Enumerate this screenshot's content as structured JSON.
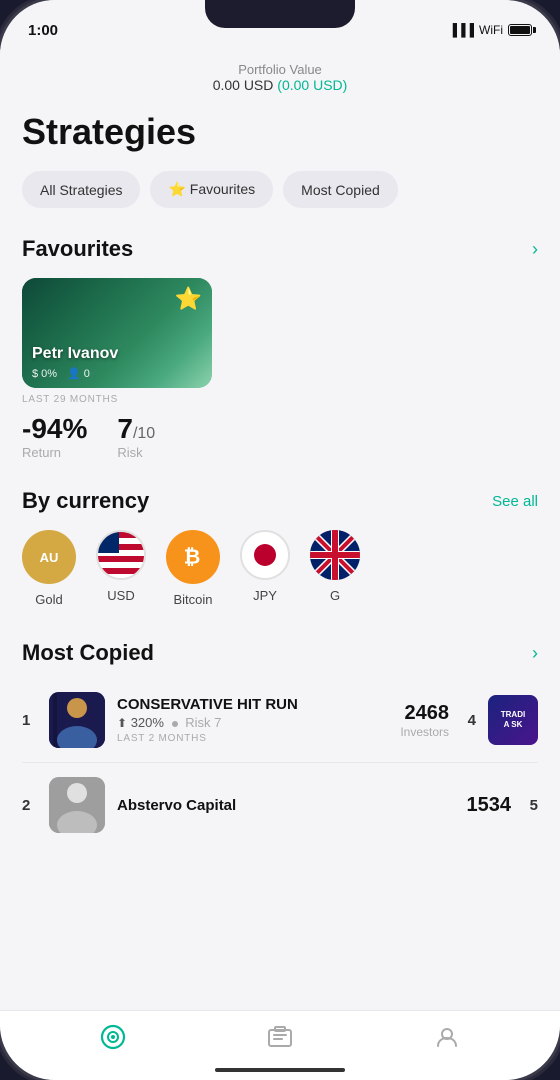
{
  "status": {
    "time": "1:00",
    "location_icon": "↗"
  },
  "portfolio": {
    "label": "Portfolio Value",
    "value": "0.00 USD",
    "change": "(0.00 USD)"
  },
  "page": {
    "title": "Strategies"
  },
  "filter_tabs": [
    {
      "id": "all",
      "label": "All Strategies",
      "active": false
    },
    {
      "id": "favourites",
      "label": "⭐ Favourites",
      "active": false
    },
    {
      "id": "most_copied",
      "label": "Most Copied",
      "active": false
    }
  ],
  "favourites": {
    "section_title": "Favourites",
    "last_months_label": "LAST 29 MONTHS",
    "trader": {
      "name": "Petr Ivanov",
      "return_pct": "0%",
      "copiers": "0",
      "star": "⭐"
    },
    "performance": {
      "return_value": "-94%",
      "return_label": "Return",
      "risk_value": "7",
      "risk_max": "/10",
      "risk_label": "Risk"
    }
  },
  "by_currency": {
    "section_title": "By currency",
    "see_all_label": "See all",
    "currencies": [
      {
        "id": "gold",
        "label": "Gold",
        "type": "gold"
      },
      {
        "id": "usd",
        "label": "USD",
        "type": "usd"
      },
      {
        "id": "bitcoin",
        "label": "Bitcoin",
        "type": "btc"
      },
      {
        "id": "jpy",
        "label": "JPY",
        "type": "jpy"
      },
      {
        "id": "gbp",
        "label": "G",
        "type": "gbp"
      }
    ]
  },
  "most_copied": {
    "section_title": "Most Copied",
    "items": [
      {
        "rank": "1",
        "name": "CONSERVATIVE HIT RUN",
        "return_pct": "320%",
        "risk": "Risk 7",
        "last_period": "LAST 2 MONTHS",
        "investors_count": "2468",
        "investors_label": "Investors",
        "rank_right": "4"
      },
      {
        "rank": "2",
        "name": "Abstervo Capital",
        "investors_count": "1534",
        "investors_label": "",
        "rank_right": "5"
      }
    ]
  },
  "bottom_nav": {
    "items": [
      {
        "id": "home",
        "icon": "◎",
        "active": true
      },
      {
        "id": "portfolio",
        "icon": "▤",
        "active": false
      },
      {
        "id": "account",
        "icon": "👤",
        "active": false
      }
    ]
  }
}
